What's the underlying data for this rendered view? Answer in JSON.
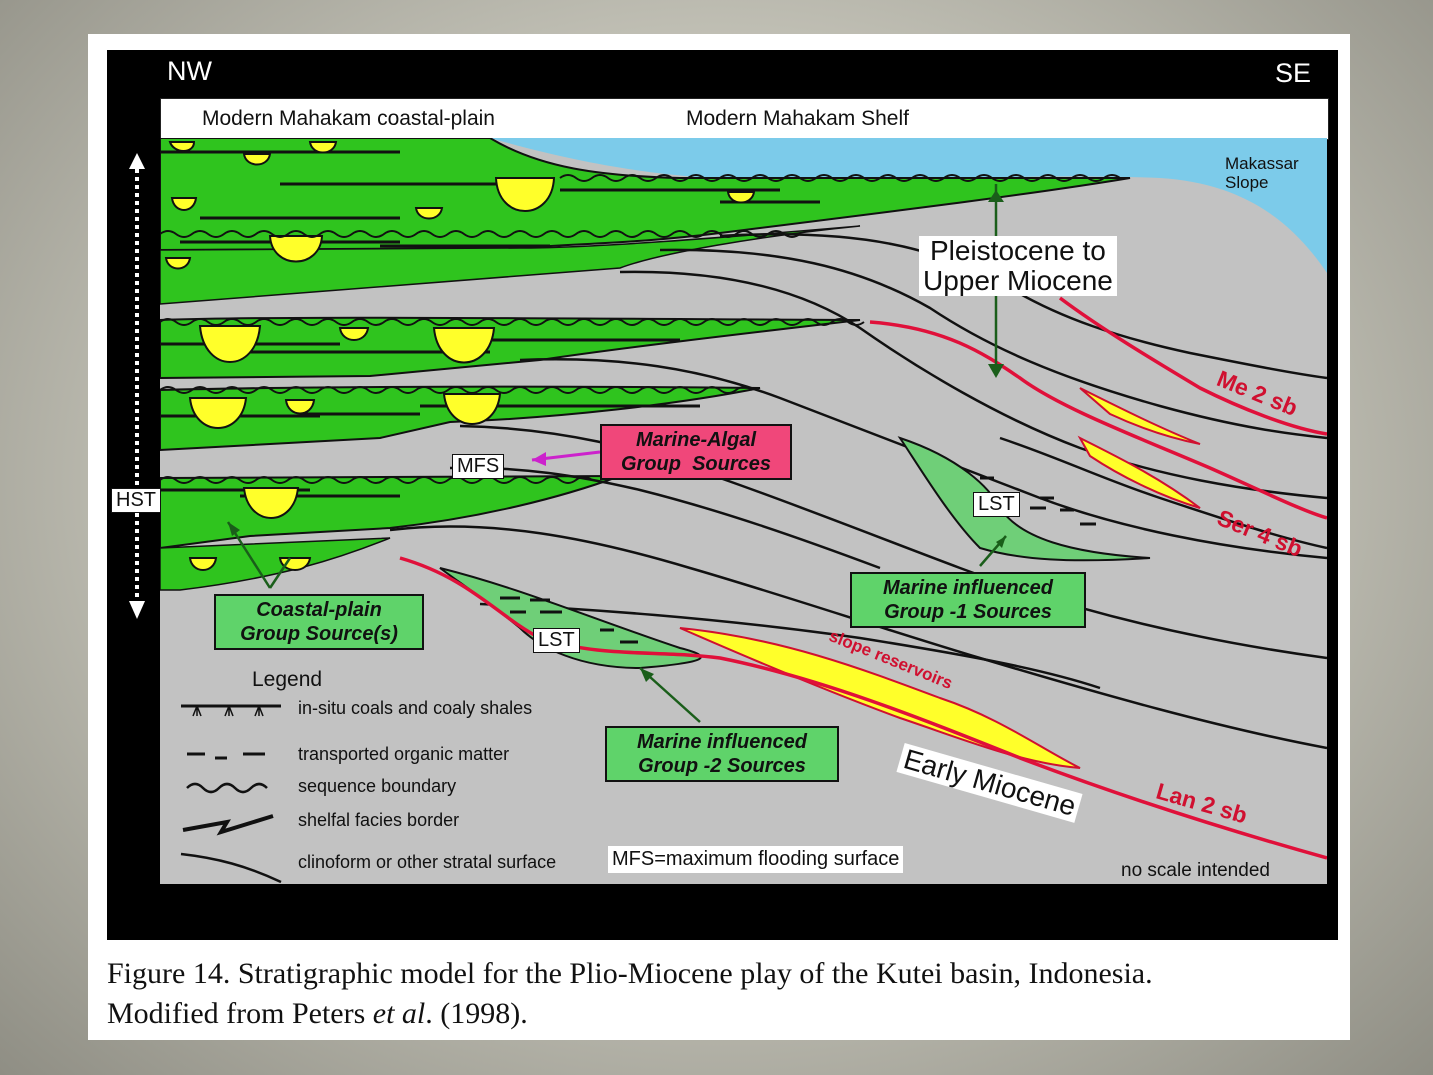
{
  "orientation": {
    "left": "NW",
    "right": "SE"
  },
  "header": {
    "left_label": "Modern Mahakam coastal-plain",
    "right_label": "Modern Mahakam Shelf"
  },
  "labels": {
    "makassar_slope": "Makassar\nSlope",
    "pleistocene": "Pleistocene to\nUpper Miocene",
    "me2sb": "Me 2 sb",
    "ser4sb": "Ser 4 sb",
    "lan2sb": "Lan 2 sb",
    "mfs": "MFS",
    "hst": "HST",
    "lst_upper": "LST",
    "lst_lower": "LST",
    "slope_reservoirs": "slope reservoirs",
    "early_miocene": "Early Miocene",
    "no_scale": "no scale intended",
    "mfs_definition": "MFS=maximum flooding surface"
  },
  "boxes": {
    "marine_algal": "Marine-Algal\nGroup  Sources",
    "marine_group1": "Marine influenced\nGroup -1 Sources",
    "marine_group2": "Marine influenced\nGroup -2 Sources",
    "coastal_plain": "Coastal-plain\nGroup Source(s)"
  },
  "legend": {
    "title": "Legend",
    "items": [
      "in-situ coals and coaly shales",
      "transported organic matter",
      "sequence boundary",
      "shelfal facies border",
      "clinoform or other stratal surface"
    ]
  },
  "colors": {
    "sea": "#7ccbea",
    "green_facies": "#2fc41e",
    "lst_green": "#6fcf78",
    "sand_yellow": "#ffff2a",
    "sequence_boundary_red": "#e0103a",
    "grey_sediment": "#c2c2c2"
  },
  "caption": {
    "line1": "Figure 14. Stratigraphic model for the Plio-Miocene play of the Kutei basin, Indonesia.",
    "line2_prefix": "Modified from Peters ",
    "line2_italic": "et al",
    "line2_suffix": ". (1998)."
  }
}
